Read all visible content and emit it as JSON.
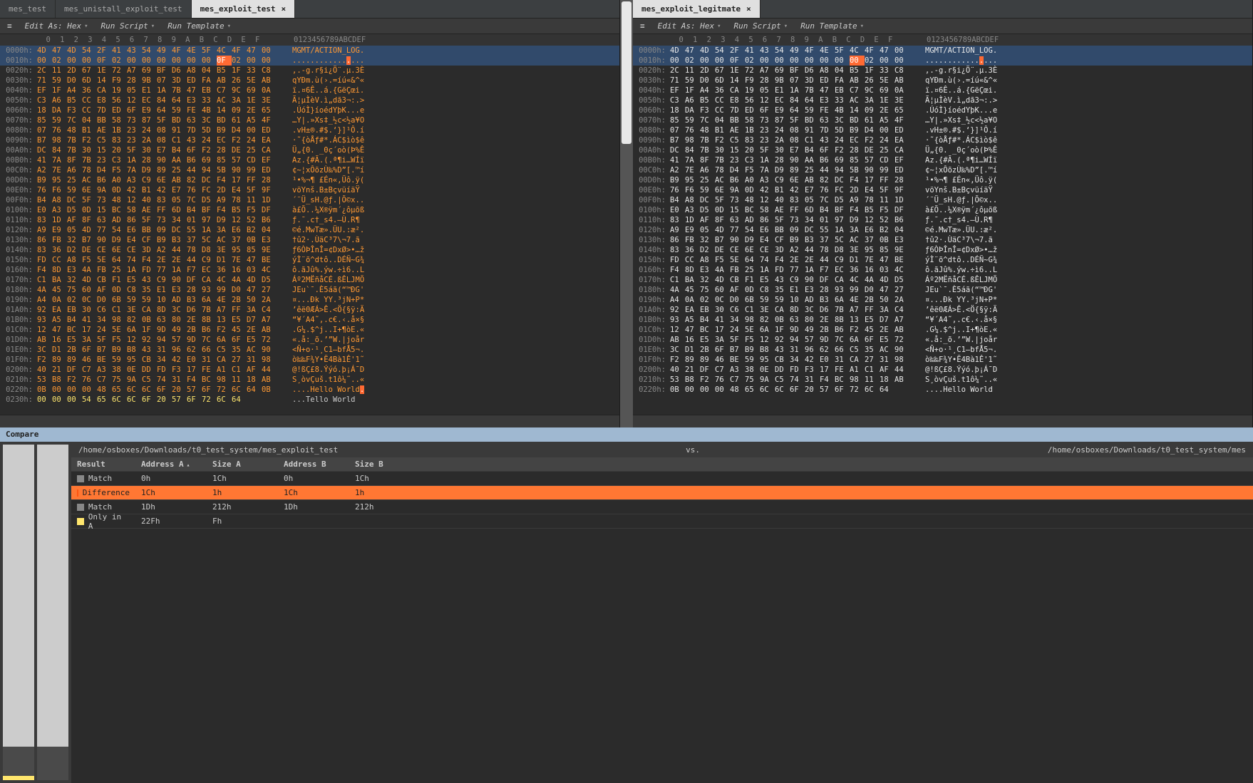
{
  "tabs_left": [
    {
      "label": "mes_test",
      "active": false,
      "closeable": false
    },
    {
      "label": "mes_unistall_exploit_test",
      "active": false,
      "closeable": false
    },
    {
      "label": "mes_exploit_test",
      "active": true,
      "closeable": true
    }
  ],
  "tabs_right": [
    {
      "label": "mes_exploit_legitmate",
      "active": true,
      "closeable": true
    }
  ],
  "toolbar": {
    "edit_as": "Edit As: Hex",
    "run_script": "Run Script",
    "run_template": "Run Template"
  },
  "ruler": {
    "hex": " 0  1  2  3  4  5  6  7  8  9  A  B  C  D  E  F",
    "ascii": "0123456789ABCDEF"
  },
  "left_rows": [
    {
      "a": "0000h:",
      "b": [
        "4D",
        "47",
        "4D",
        "54",
        "2F",
        "41",
        "43",
        "54",
        "49",
        "4F",
        "4E",
        "5F",
        "4C",
        "4F",
        "47",
        "00"
      ],
      "s": "MGMT/ACTION_LOG.",
      "t": "diff",
      "hl": true
    },
    {
      "a": "0010h:",
      "b": [
        "00",
        "02",
        "00",
        "00",
        "0F",
        "02",
        "00",
        "00",
        "00",
        "00",
        "00",
        "00",
        "0F",
        "02",
        "00",
        "00"
      ],
      "s": "................",
      "t": "diff",
      "hl": true,
      "markIdx": 12
    },
    {
      "a": "0020h:",
      "b": [
        "2C",
        "11",
        "2D",
        "67",
        "1E",
        "72",
        "A7",
        "69",
        "BF",
        "D6",
        "A8",
        "04",
        "B5",
        "1F",
        "33",
        "C8"
      ],
      "s": ",.-g.r§i¿Ö¨.µ.3È",
      "t": "diff"
    },
    {
      "a": "0030h:",
      "b": [
        "71",
        "59",
        "D0",
        "6D",
        "14",
        "F9",
        "28",
        "9B",
        "07",
        "3D",
        "ED",
        "FA",
        "AB",
        "26",
        "5E",
        "AB"
      ],
      "s": "qYÐm.ù(›.=íú«&^«",
      "t": "diff"
    },
    {
      "a": "0040h:",
      "b": [
        "EF",
        "1F",
        "A4",
        "36",
        "CA",
        "19",
        "05",
        "E1",
        "1A",
        "7B",
        "47",
        "EB",
        "C7",
        "9C",
        "69",
        "0A"
      ],
      "s": "ï.¤6Ê..á.{GëÇœi.",
      "t": "diff"
    },
    {
      "a": "0050h:",
      "b": [
        "C3",
        "A6",
        "B5",
        "CC",
        "E8",
        "56",
        "12",
        "EC",
        "84",
        "64",
        "E3",
        "33",
        "AC",
        "3A",
        "1E",
        "3E"
      ],
      "s": "Ã¦µÌèV.ì„dã3¬:.>",
      "t": "diff"
    },
    {
      "a": "0060h:",
      "b": [
        "18",
        "DA",
        "F3",
        "CC",
        "7D",
        "ED",
        "6F",
        "E9",
        "64",
        "59",
        "FE",
        "4B",
        "14",
        "09",
        "2E",
        "65"
      ],
      "s": ".ÚóÌ}íoédYþK...e",
      "t": "diff"
    },
    {
      "a": "0070h:",
      "b": [
        "85",
        "59",
        "7C",
        "04",
        "BB",
        "58",
        "73",
        "87",
        "5F",
        "BD",
        "63",
        "3C",
        "BD",
        "61",
        "A5",
        "4F"
      ],
      "s": "…Y|.»Xs‡_½c<½a¥O",
      "t": "diff"
    },
    {
      "a": "0080h:",
      "b": [
        "07",
        "76",
        "48",
        "B1",
        "AE",
        "1B",
        "23",
        "24",
        "08",
        "91",
        "7D",
        "5D",
        "B9",
        "D4",
        "00",
        "ED"
      ],
      "s": ".vH±®.#$.‘}]¹Ô.í",
      "t": "diff"
    },
    {
      "a": "0090h:",
      "b": [
        "B7",
        "98",
        "7B",
        "F2",
        "C5",
        "83",
        "23",
        "2A",
        "08",
        "C1",
        "43",
        "24",
        "EC",
        "F2",
        "24",
        "EA"
      ],
      "s": "·˜{òÅƒ#*.ÁC$ìò$ê",
      "t": "diff"
    },
    {
      "a": "00A0h:",
      "b": [
        "DC",
        "84",
        "7B",
        "30",
        "15",
        "20",
        "5F",
        "30",
        "E7",
        "B4",
        "6F",
        "F2",
        "28",
        "DE",
        "25",
        "CA"
      ],
      "s": "Ü„{0. _0ç´oò(Þ%Ê",
      "t": "diff"
    },
    {
      "a": "00B0h:",
      "b": [
        "41",
        "7A",
        "8F",
        "7B",
        "23",
        "C3",
        "1A",
        "28",
        "90",
        "AA",
        "B6",
        "69",
        "85",
        "57",
        "CD",
        "EF"
      ],
      "s": "Az.{#Ã.(.ª¶i…WÍï",
      "t": "diff"
    },
    {
      "a": "00C0h:",
      "b": [
        "A2",
        "7E",
        "A6",
        "78",
        "D4",
        "F5",
        "7A",
        "D9",
        "89",
        "25",
        "44",
        "94",
        "5B",
        "90",
        "99",
        "ED"
      ],
      "s": "¢~¦xÔõzÙ‰%D”[.™í",
      "t": "diff"
    },
    {
      "a": "00D0h:",
      "b": [
        "B9",
        "95",
        "25",
        "AC",
        "B6",
        "A0",
        "A3",
        "C9",
        "6E",
        "AB",
        "82",
        "DC",
        "F4",
        "17",
        "FF",
        "28"
      ],
      "s": "¹•%¬¶ £Én«‚Üô.ÿ(",
      "t": "diff"
    },
    {
      "a": "00E0h:",
      "b": [
        "76",
        "F6",
        "59",
        "6E",
        "9A",
        "0D",
        "42",
        "B1",
        "42",
        "E7",
        "76",
        "FC",
        "2D",
        "E4",
        "5F",
        "9F"
      ],
      "s": "vöYnš.B±BçvüíäŸ",
      "t": "diff"
    },
    {
      "a": "00F0h:",
      "b": [
        "B4",
        "A8",
        "DC",
        "5F",
        "73",
        "48",
        "12",
        "40",
        "83",
        "05",
        "7C",
        "D5",
        "A9",
        "78",
        "11",
        "1D"
      ],
      "s": "´¨Ü_sH.@ƒ.|Õ©x..",
      "t": "diff"
    },
    {
      "a": "0100h:",
      "b": [
        "E0",
        "A3",
        "D5",
        "0D",
        "15",
        "BC",
        "58",
        "AE",
        "FF",
        "6D",
        "B4",
        "BF",
        "F4",
        "B5",
        "F5",
        "DF"
      ],
      "s": "à£Õ..¼X®ÿm´¿ôµõß",
      "t": "diff"
    },
    {
      "a": "0110h:",
      "b": [
        "83",
        "1D",
        "AF",
        "8F",
        "63",
        "AD",
        "86",
        "5F",
        "73",
        "34",
        "01",
        "97",
        "D9",
        "12",
        "52",
        "B6"
      ],
      "s": "ƒ.¯.c­†_s4.—Ù.R¶",
      "t": "diff"
    },
    {
      "a": "0120h:",
      "b": [
        "A9",
        "E9",
        "05",
        "4D",
        "77",
        "54",
        "E6",
        "BB",
        "09",
        "DC",
        "55",
        "1A",
        "3A",
        "E6",
        "B2",
        "04"
      ],
      "s": "©é.MwTæ».ÜU.:æ².",
      "t": "diff"
    },
    {
      "a": "0130h:",
      "b": [
        "86",
        "FB",
        "32",
        "B7",
        "90",
        "D9",
        "E4",
        "CF",
        "B9",
        "B3",
        "37",
        "5C",
        "AC",
        "37",
        "0B",
        "E3"
      ],
      "s": "†û2·.ÙäϹ³7\\¬7.ã",
      "t": "diff"
    },
    {
      "a": "0140h:",
      "b": [
        "83",
        "36",
        "D2",
        "DE",
        "CE",
        "6E",
        "CE",
        "3D",
        "A2",
        "44",
        "78",
        "D8",
        "3E",
        "95",
        "85",
        "9E"
      ],
      "s": "ƒ6ÒÞÎnÎ=¢DxØ>•…ž",
      "t": "diff"
    },
    {
      "a": "0150h:",
      "b": [
        "FD",
        "CC",
        "A8",
        "F5",
        "5E",
        "64",
        "74",
        "F4",
        "2E",
        "2E",
        "44",
        "C9",
        "D1",
        "7E",
        "47",
        "BE"
      ],
      "s": "ýÌ¨õ^dtô..DÉÑ~G¾",
      "t": "diff"
    },
    {
      "a": "0160h:",
      "b": [
        "F4",
        "8D",
        "E3",
        "4A",
        "FB",
        "25",
        "1A",
        "FD",
        "77",
        "1A",
        "F7",
        "EC",
        "36",
        "16",
        "03",
        "4C"
      ],
      "s": "ô.ãJû%.ýw.÷ì6..L",
      "t": "diff"
    },
    {
      "a": "0170h:",
      "b": [
        "C1",
        "BA",
        "32",
        "4D",
        "CB",
        "F1",
        "E5",
        "43",
        "C9",
        "90",
        "DF",
        "CA",
        "4C",
        "4A",
        "4D",
        "D5"
      ],
      "s": "Áº2MËñåCÉ.ßÊLJMÕ",
      "t": "diff"
    },
    {
      "a": "0180h:",
      "b": [
        "4A",
        "45",
        "75",
        "60",
        "AF",
        "0D",
        "C8",
        "35",
        "E1",
        "E3",
        "28",
        "93",
        "99",
        "D0",
        "47",
        "27"
      ],
      "s": "JEu`¯.È5áã(“™ÐG'",
      "t": "diff"
    },
    {
      "a": "0190h:",
      "b": [
        "A4",
        "0A",
        "02",
        "0C",
        "D0",
        "6B",
        "59",
        "59",
        "10",
        "AD",
        "B3",
        "6A",
        "4E",
        "2B",
        "50",
        "2A"
      ],
      "s": "¤...Ðk YY.­³jN+P*",
      "t": "diff"
    },
    {
      "a": "01A0h:",
      "b": [
        "92",
        "EA",
        "EB",
        "30",
        "C6",
        "C1",
        "3E",
        "CA",
        "8D",
        "3C",
        "D6",
        "7B",
        "A7",
        "FF",
        "3A",
        "C4"
      ],
      "s": "’êë0ÆÁ>Ê.<Ö{§ÿ:Ä",
      "t": "diff"
    },
    {
      "a": "01B0h:",
      "b": [
        "93",
        "A5",
        "B4",
        "41",
        "34",
        "98",
        "82",
        "0B",
        "63",
        "80",
        "2E",
        "8B",
        "13",
        "E5",
        "D7",
        "A7"
      ],
      "s": "“¥´A4˜‚.c€.‹.å×§",
      "t": "diff"
    },
    {
      "a": "01C0h:",
      "b": [
        "12",
        "47",
        "BC",
        "17",
        "24",
        "5E",
        "6A",
        "1F",
        "9D",
        "49",
        "2B",
        "B6",
        "F2",
        "45",
        "2E",
        "AB"
      ],
      "s": ".G¼.$^j..I+¶òE.«",
      "t": "diff"
    },
    {
      "a": "01D0h:",
      "b": [
        "AB",
        "16",
        "E5",
        "3A",
        "5F",
        "F5",
        "12",
        "92",
        "94",
        "57",
        "9D",
        "7C",
        "6A",
        "6F",
        "E5",
        "72"
      ],
      "s": "«.å:_õ.’”W.|joår",
      "t": "diff"
    },
    {
      "a": "01E0h:",
      "b": [
        "3C",
        "D1",
        "2B",
        "6F",
        "B7",
        "B9",
        "B8",
        "43",
        "31",
        "96",
        "62",
        "66",
        "C5",
        "35",
        "AC",
        "90"
      ],
      "s": "<Ñ+o·¹¸C1–bfÅ5¬.",
      "t": "diff"
    },
    {
      "a": "01F0h:",
      "b": [
        "F2",
        "89",
        "89",
        "46",
        "BE",
        "59",
        "95",
        "CB",
        "34",
        "42",
        "E0",
        "31",
        "CA",
        "27",
        "31",
        "98"
      ],
      "s": "ò‰‰F¾Y•Ë4Bà1Ê'1˜",
      "t": "diff"
    },
    {
      "a": "0200h:",
      "b": [
        "40",
        "21",
        "DF",
        "C7",
        "A3",
        "38",
        "0E",
        "DD",
        "FD",
        "F3",
        "17",
        "FE",
        "A1",
        "C1",
        "AF",
        "44"
      ],
      "s": "@!ßÇ£8.Ýýó.þ¡Á¯D",
      "t": "diff"
    },
    {
      "a": "0210h:",
      "b": [
        "53",
        "B8",
        "F2",
        "76",
        "C7",
        "75",
        "9A",
        "C5",
        "74",
        "31",
        "F4",
        "BC",
        "98",
        "11",
        "18",
        "AB"
      ],
      "s": "S¸òvÇuš.t1ô¼˜..«",
      "t": "diff"
    },
    {
      "a": "0220h:",
      "b": [
        "0B",
        "00",
        "00",
        "00",
        "48",
        "65",
        "6C",
        "6C",
        "6F",
        "20",
        "57",
        "6F",
        "72",
        "6C",
        "64",
        "0B"
      ],
      "s": "....Hello World.",
      "t": "diff",
      "asciiMark": true
    },
    {
      "a": "0230h:",
      "b": [
        "00",
        "00",
        "00",
        "54",
        "65",
        "6C",
        "6C",
        "6F",
        "20",
        "57",
        "6F",
        "72",
        "6C",
        "64",
        "",
        ""
      ],
      "s": "...Tello World",
      "t": "onlya"
    }
  ],
  "right_rows_same_as_left_until": "0220h",
  "right_last": {
    "a": "0220h:",
    "b": [
      "0B",
      "00",
      "00",
      "00",
      "48",
      "65",
      "6C",
      "6C",
      "6F",
      "20",
      "57",
      "6F",
      "72",
      "6C",
      "64",
      "  "
    ],
    "s": "....Hello World",
    "t": "same"
  },
  "right_row_0010_markIdx": 12,
  "compare": {
    "title": "Compare",
    "path_a": "/home/osboxes/Downloads/t0_test_system/mes_exploit_test",
    "vs": "vs.",
    "path_b": "/home/osboxes/Downloads/t0_test_system/mes",
    "headers": [
      "Result",
      "Address A",
      "Size A",
      "Address B",
      "Size B"
    ],
    "rows": [
      {
        "type": "match",
        "r": "Match",
        "aa": "0h",
        "sa": "1Ch",
        "ab": "0h",
        "sb": "1Ch"
      },
      {
        "type": "diff",
        "r": "Difference",
        "aa": "1Ch",
        "sa": "1h",
        "ab": "1Ch",
        "sb": "1h"
      },
      {
        "type": "match",
        "r": "Match",
        "aa": "1Dh",
        "sa": "212h",
        "ab": "1Dh",
        "sb": "212h"
      },
      {
        "type": "onlya",
        "r": "Only in A",
        "aa": "22Fh",
        "sa": "Fh",
        "ab": "",
        "sb": ""
      }
    ]
  }
}
